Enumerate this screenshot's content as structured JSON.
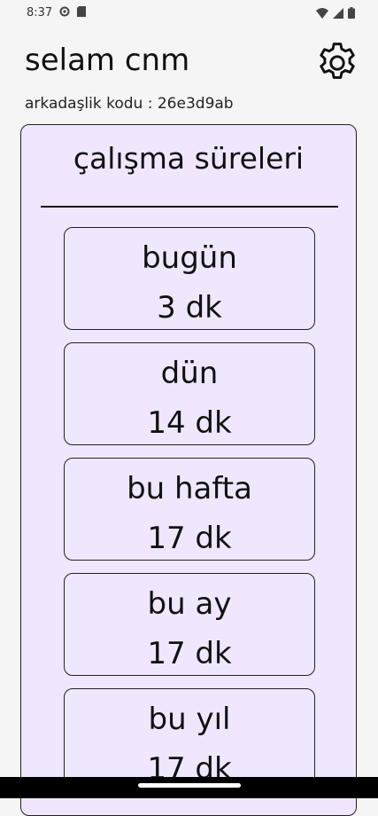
{
  "status_bar": {
    "time": "8:37"
  },
  "header": {
    "title": "selam cnm",
    "friend_code": "arkadaşlik kodu : 26e3d9ab"
  },
  "panel": {
    "title": "çalışma süreleri",
    "stats": [
      {
        "label": "bugün",
        "value": "3 dk"
      },
      {
        "label": "dün",
        "value": "14 dk"
      },
      {
        "label": "bu hafta",
        "value": "17 dk"
      },
      {
        "label": "bu ay",
        "value": "17 dk"
      },
      {
        "label": "bu yıl",
        "value": "17 dk"
      }
    ]
  },
  "icons": {
    "settings": "gear-icon"
  },
  "colors": {
    "panel_background": "#f0e7ff",
    "border": "#222222"
  }
}
